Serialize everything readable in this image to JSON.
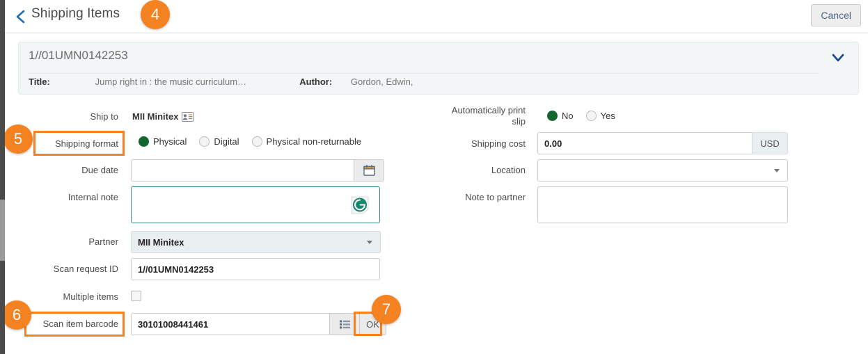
{
  "header": {
    "title": "Shipping Items",
    "back_icon": "chevron-left-icon",
    "cancel_label": "Cancel"
  },
  "item_card": {
    "id": "1//01UMN0142253",
    "title_label": "Title:",
    "title_value": "Jump right in : the music curriculum…",
    "author_label": "Author:",
    "author_value": "Gordon, Edwin,",
    "collapse_icon": "chevron-down-icon"
  },
  "form": {
    "left": {
      "ship_to_label": "Ship to",
      "ship_to_value": "MII Minitex",
      "ship_to_icon": "contact-card-icon",
      "shipping_format_label": "Shipping format",
      "shipping_format_options": [
        "Physical",
        "Digital",
        "Physical non-returnable"
      ],
      "shipping_format_selected": "Physical",
      "due_date_label": "Due date",
      "due_date_value": "",
      "due_date_icon": "calendar-icon",
      "internal_note_label": "Internal note",
      "internal_note_value": "",
      "internal_note_assist_icon": "grammarly-icon",
      "partner_label": "Partner",
      "partner_value": "MII Minitex",
      "partner_caret_icon": "caret-down-icon",
      "scan_request_id_label": "Scan request ID",
      "scan_request_id_value": "1//01UMN0142253",
      "multiple_items_label": "Multiple items",
      "multiple_items_checked": false,
      "scan_item_barcode_label": "Scan item barcode",
      "scan_item_barcode_value": "30101008441461",
      "scan_list_icon": "list-icon",
      "ok_label": "OK"
    },
    "right": {
      "auto_print_label": "Automatically print slip",
      "auto_print_options": [
        "No",
        "Yes"
      ],
      "auto_print_selected": "No",
      "shipping_cost_label": "Shipping cost",
      "shipping_cost_value": "0.00",
      "shipping_cost_currency": "USD",
      "location_label": "Location",
      "location_value": "",
      "location_caret_icon": "caret-down-icon",
      "note_to_partner_label": "Note to partner",
      "note_to_partner_value": ""
    }
  },
  "annotations": {
    "badges": [
      "4",
      "5",
      "6",
      "7"
    ]
  },
  "colors": {
    "accent_orange": "#f58220",
    "radio_selected_green": "#14662f",
    "link_blue": "#1f6fb4",
    "card_bg": "#f2f6f7"
  }
}
